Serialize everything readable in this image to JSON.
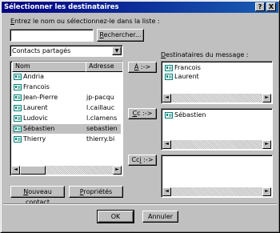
{
  "window": {
    "title": "Sélectionner les destinataires",
    "help_glyph": "?",
    "close_glyph": "X"
  },
  "search": {
    "label_pre": "E",
    "label_post": "ntrez le nom ou sélectionnez-le dans la liste :",
    "input_value": "",
    "button_pre": "",
    "button_ul": "R",
    "button_post": "echercher..."
  },
  "source": {
    "selected": "Contacts partagés",
    "dropdown_glyph": "▼"
  },
  "contacts": {
    "columns": [
      "Nom",
      "Adresse"
    ],
    "rows": [
      {
        "name": "Andria",
        "address": ""
      },
      {
        "name": "Francois",
        "address": ""
      },
      {
        "name": "Jean-Pierre",
        "address": "jp-pacqu"
      },
      {
        "name": "Laurent",
        "address": "l.caillauc"
      },
      {
        "name": "Ludovic",
        "address": "l.clamens"
      },
      {
        "name": "Sébastien",
        "address": "sebastien"
      },
      {
        "name": "Thierry",
        "address": "thierry.bi"
      }
    ],
    "selected_index": 5
  },
  "actions": {
    "new_contact_pre": "",
    "new_contact_ul": "N",
    "new_contact_post": "ouveau contact",
    "properties_pre": "",
    "properties_ul": "P",
    "properties_post": "ropriétés"
  },
  "recipients": {
    "label_pre": "",
    "label_ul": "D",
    "label_post": "estinataires du message :",
    "to_pre": "",
    "to_ul": "À",
    "to_post": " :->",
    "cc_pre": "",
    "cc_ul": "C",
    "cc_post": "c :->",
    "bcc_pre": "Cc",
    "bcc_ul": "i",
    "bcc_post": " :->",
    "to_list": [
      "Francois",
      "Laurent"
    ],
    "cc_list": [
      "Sébastien"
    ],
    "bcc_list": []
  },
  "footer": {
    "ok_label": "OK",
    "cancel_label": "Annuler"
  },
  "scroll": {
    "left_glyph": "◄",
    "right_glyph": "►",
    "up_glyph": "▲",
    "down_glyph": "▼"
  }
}
